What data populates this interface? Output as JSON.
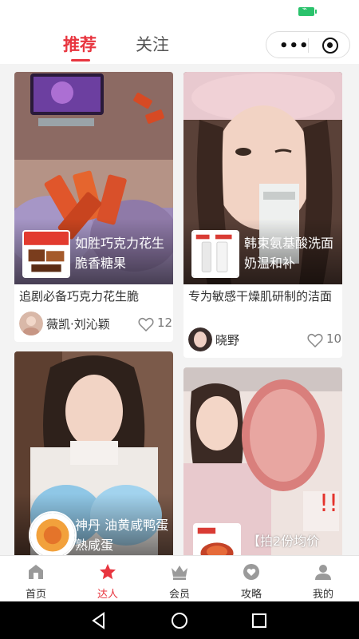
{
  "header": {
    "tabs": [
      {
        "label": "推荐",
        "active": true
      },
      {
        "label": "关注",
        "active": false
      }
    ],
    "capsule_more": "•••"
  },
  "feed": {
    "cards": [
      {
        "product_name": "如胜巧克力花生脆香糖果",
        "title": "追剧必备巧克力花生脆",
        "author": "薇凯·刘沁颖",
        "likes": "12"
      },
      {
        "product_name": "韩束氨基酸洗面奶温和补",
        "title": "专为敏感干燥肌研制的洁面",
        "author": "晓野",
        "likes": "10"
      },
      {
        "product_name": "神丹 油黄咸鸭蛋 熟咸蛋"
      },
      {
        "product_name": "【拍2份均价"
      }
    ]
  },
  "tabbar": {
    "items": [
      {
        "label": "首页",
        "icon": "home-icon",
        "active": false
      },
      {
        "label": "达人",
        "icon": "star-icon",
        "active": true
      },
      {
        "label": "会员",
        "icon": "crown-icon",
        "active": false
      },
      {
        "label": "攻略",
        "icon": "heart-badge-icon",
        "active": false
      },
      {
        "label": "我的",
        "icon": "person-icon",
        "active": false
      }
    ]
  },
  "colors": {
    "accent": "#e8353f",
    "inactive_icon": "#9a9a9a"
  }
}
